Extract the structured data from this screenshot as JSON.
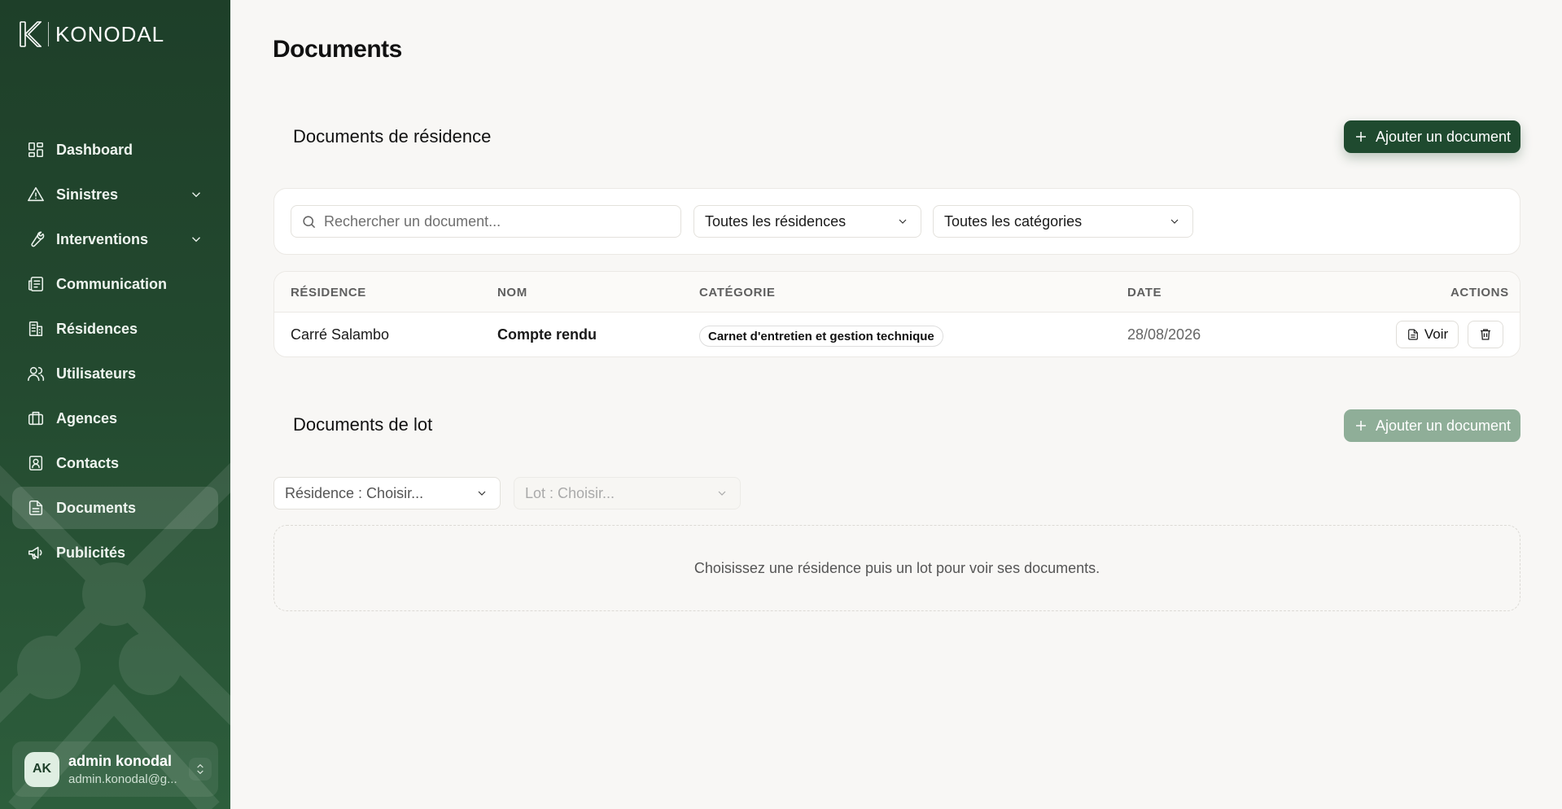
{
  "brand": {
    "name": "KONODAL"
  },
  "sidebar": {
    "items": [
      {
        "label": "Dashboard",
        "icon": "dashboard-icon",
        "has_children": false,
        "active": false
      },
      {
        "label": "Sinistres",
        "icon": "warning-icon",
        "has_children": true,
        "active": false
      },
      {
        "label": "Interventions",
        "icon": "wrench-icon",
        "has_children": true,
        "active": false
      },
      {
        "label": "Communication",
        "icon": "newspaper-icon",
        "has_children": false,
        "active": false
      },
      {
        "label": "Résidences",
        "icon": "building-icon",
        "has_children": false,
        "active": false
      },
      {
        "label": "Utilisateurs",
        "icon": "users-icon",
        "has_children": false,
        "active": false
      },
      {
        "label": "Agences",
        "icon": "briefcase-icon",
        "has_children": false,
        "active": false
      },
      {
        "label": "Contacts",
        "icon": "contact-icon",
        "has_children": false,
        "active": false
      },
      {
        "label": "Documents",
        "icon": "file-icon",
        "has_children": false,
        "active": true
      },
      {
        "label": "Publicités",
        "icon": "megaphone-icon",
        "has_children": false,
        "active": false
      }
    ]
  },
  "user": {
    "initials": "AK",
    "name": "admin konodal",
    "email": "admin.konodal@g..."
  },
  "page": {
    "title": "Documents"
  },
  "residence_docs": {
    "title": "Documents de résidence",
    "add_label": "Ajouter un document",
    "search_placeholder": "Rechercher un document...",
    "filter_residence": "Toutes les résidences",
    "filter_category": "Toutes les catégories",
    "columns": {
      "residence": "RÉSIDENCE",
      "nom": "NOM",
      "categorie": "CATÉGORIE",
      "date": "DATE",
      "actions": "ACTIONS"
    },
    "rows": [
      {
        "residence": "Carré Salambo",
        "nom": "Compte rendu",
        "categorie": "Carnet d'entretien et gestion technique",
        "date": "28/08/2026",
        "view_label": "Voir"
      }
    ]
  },
  "lot_docs": {
    "title": "Documents de lot",
    "add_label": "Ajouter un document",
    "residence_select": "Résidence : Choisir...",
    "lot_select": "Lot : Choisir...",
    "empty_message": "Choisissez une résidence puis un lot pour voir ses documents."
  },
  "colors": {
    "sidebar": "#1e3f29",
    "accent": "#1f4a2f",
    "accent_disabled": "#8fae98",
    "background": "#f8f7f5"
  }
}
